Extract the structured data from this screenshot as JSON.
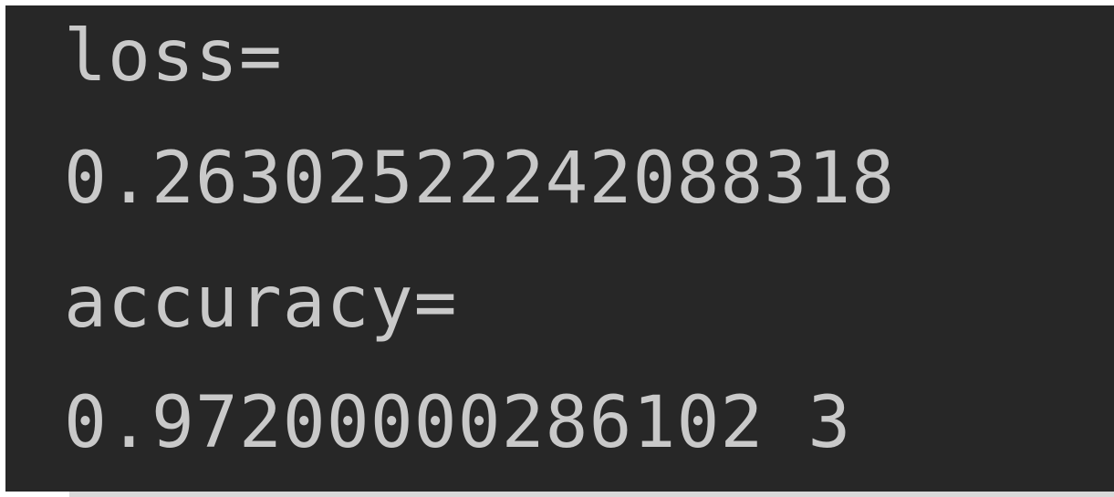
{
  "console": {
    "lines": [
      "loss=",
      "0.26302522242088318",
      "accuracy=",
      "0.97200000286102 3"
    ]
  }
}
